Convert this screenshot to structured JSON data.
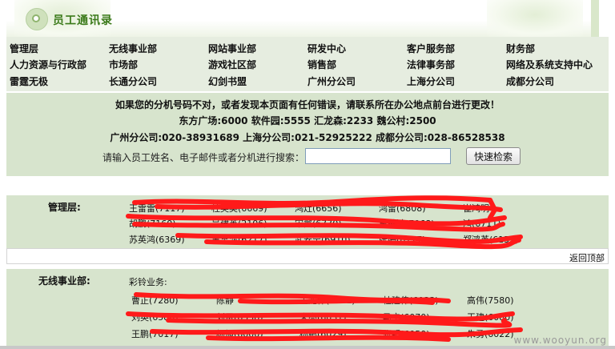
{
  "header": {
    "title": "员工通讯录"
  },
  "nav": {
    "rows": [
      [
        "管理层",
        "无线事业部",
        "网站事业部",
        "研发中心",
        "客户服务部",
        "财务部"
      ],
      [
        "人力资源与行政部",
        "市场部",
        "游戏社区部",
        "销售部",
        "法律事务部",
        "网络及系统支持中心"
      ],
      [
        "雷霆无极",
        "长通分公司",
        "幻剑书盟",
        "广州分公司",
        "上海分公司",
        "成都分公司"
      ]
    ]
  },
  "info": {
    "notice": "如果您的分机号码不对，或者发现本页面有任何错误，请联系所在办公地点前台进行更改！",
    "phones1": "东方广场:6000    软件园:5555    汇龙森:2233    魏公村:2500",
    "phones2": "广州分公司:020-38931689    上海分公司:021-52925222    成都分公司:028-86528538",
    "search_prompt": "请输入员工姓名、电子邮件或者分机进行搜索：",
    "search_value": "",
    "search_button": "快速检索"
  },
  "sections": [
    {
      "label": "管理层:",
      "employees": [
        [
          "王雷雷(7117)",
          "杜英奕(6669)",
          "鸿灶(6656)",
          "鸿雷(6808)",
          "崔鸿明"
        ],
        [
          "胡鹏(7160)",
          "吴建英(2106)",
          "宋翼(6770)",
          "王鹏鸿(7068)",
          "鸿(6711)"
        ],
        [
          "苏英鸿(6369)",
          "王雷鸿(6217)",
          "武安宁(6910)",
          "张婷(6177)",
          "郑鸿英(6152)"
        ]
      ],
      "back_link": "返回顶部"
    },
    {
      "label": "无线事业部:",
      "subgroup": "彩铃业务:",
      "employees": [
        [
          "曹正(7280)",
          "陈静",
          "王龙伟(7281)",
          "杜建伟(6033)",
          "高伟(7580)"
        ],
        [
          "刘英(6580)",
          "刘雷(6558)",
          "朱亮(6031)",
          "马宁(6070)",
          "王建(6080)"
        ],
        [
          "王鹏(7017)",
          "杨旭(6000)",
          "杨鹏(6029)",
          "张明(6050)",
          "朱勇(6022)"
        ]
      ]
    }
  ],
  "watermark": "www.wooyun.org",
  "colors": {
    "panel": "#d7e4cd",
    "nav": "#e6ede0",
    "title": "#3b7a1a",
    "redaction": "#ff1a1a"
  }
}
